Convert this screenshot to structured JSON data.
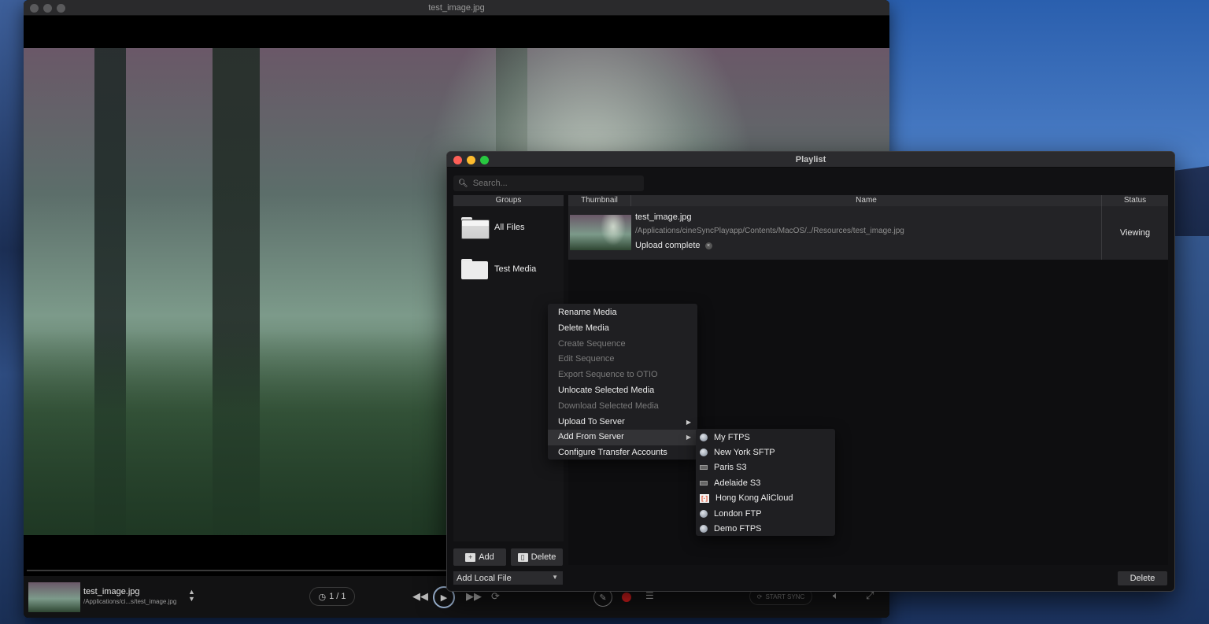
{
  "viewer": {
    "title": "test_image.jpg",
    "controls": {
      "media_name": "test_image.jpg",
      "media_path": "/Applications/ci...s/test_image.jpg",
      "counter": "1 / 1",
      "start_sync_label": "START SYNC"
    }
  },
  "playlist": {
    "title": "Playlist",
    "search": {
      "placeholder": "Search..."
    },
    "groups": {
      "header": "Groups",
      "items": [
        {
          "label": "All Files"
        },
        {
          "label": "Test Media"
        }
      ],
      "add_label": "Add",
      "delete_label": "Delete",
      "add_local_label": "Add Local File"
    },
    "media": {
      "columns": {
        "thumbnail": "Thumbnail",
        "name": "Name",
        "status": "Status"
      },
      "rows": [
        {
          "name": "test_image.jpg",
          "path": "/Applications/cineSyncPlayapp/Contents/MacOS/../Resources/test_image.jpg",
          "upload_status": "Upload complete",
          "status": "Viewing"
        }
      ]
    },
    "delete_label": "Delete"
  },
  "context_menu": {
    "items": [
      {
        "label": "Rename Media",
        "enabled": true
      },
      {
        "label": "Delete Media",
        "enabled": true
      },
      {
        "label": "Create Sequence",
        "enabled": false
      },
      {
        "label": "Edit Sequence",
        "enabled": false
      },
      {
        "label": "Export Sequence to OTIO",
        "enabled": false
      },
      {
        "label": "Unlocate Selected Media",
        "enabled": true
      },
      {
        "label": "Download Selected Media",
        "enabled": false
      },
      {
        "label": "Upload To Server",
        "enabled": true
      },
      {
        "label": "Add From Server",
        "enabled": true
      },
      {
        "label": "Configure Transfer Accounts",
        "enabled": true
      }
    ]
  },
  "submenu": {
    "items": [
      {
        "label": "My FTPS",
        "icon": "server-icon"
      },
      {
        "label": "New York SFTP",
        "icon": "server-icon"
      },
      {
        "label": "Paris S3",
        "icon": "s3-icon"
      },
      {
        "label": "Adelaide S3",
        "icon": "s3-icon"
      },
      {
        "label": "Hong Kong AliCloud",
        "icon": "alicloud-icon"
      },
      {
        "label": "London FTP",
        "icon": "server-icon"
      },
      {
        "label": "Demo FTPS",
        "icon": "server-icon"
      }
    ]
  },
  "colors": {
    "record": "#e01e1e",
    "close_light": "#fe5f57",
    "minimize_light": "#febc2e",
    "zoom_light": "#28c840"
  }
}
